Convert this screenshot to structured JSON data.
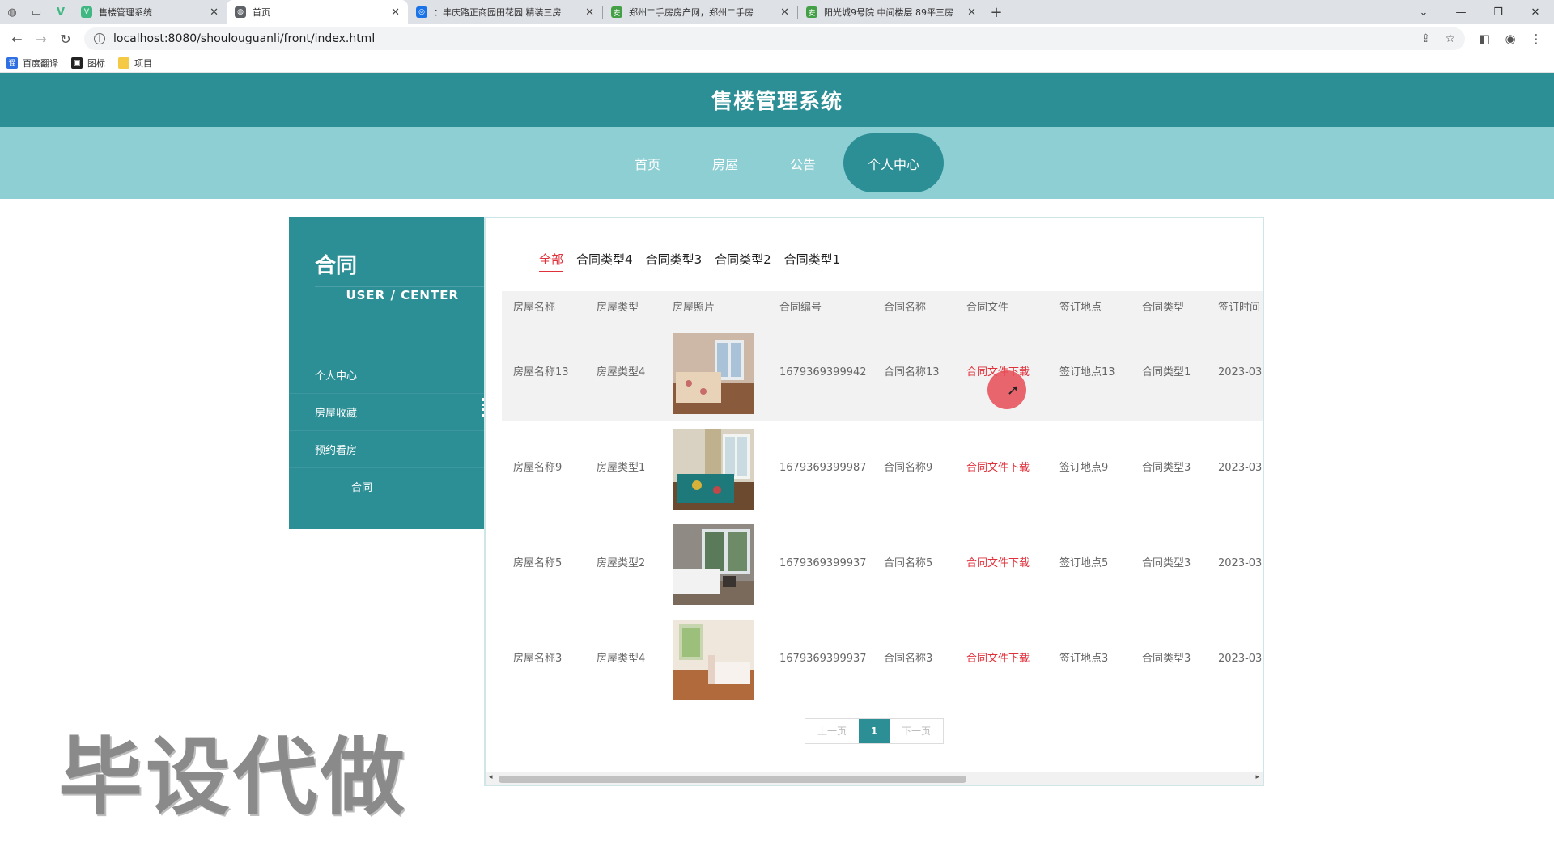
{
  "browser": {
    "tabs": [
      {
        "title": "售楼管理系统",
        "icon": "vue-icon",
        "color": "#41b883",
        "active": false
      },
      {
        "title": "首页",
        "icon": "globe-icon",
        "color": "#5f6368",
        "active": true
      },
      {
        "title": "：丰庆路正商园田花园 精装三房",
        "icon": "browser-icon",
        "color": "#1a73e8",
        "active": false
      },
      {
        "title": "郑州二手房房产网，郑州二手房",
        "icon": "anjuke-icon",
        "color": "#43a047",
        "active": false
      },
      {
        "title": "阳光城9号院 中间楼层 89平三房",
        "icon": "anjuke-icon",
        "color": "#43a047",
        "active": false
      }
    ],
    "url": "localhost:8080/shoulouguanli/front/index.html",
    "bookmarks": [
      "百度翻译",
      "图标",
      "项目"
    ]
  },
  "site": {
    "title": "售楼管理系统",
    "nav": [
      "首页",
      "房屋",
      "公告",
      "个人中心"
    ]
  },
  "sidebar": {
    "title": "合同",
    "subtitle": "USER / CENTER",
    "items": [
      "个人中心",
      "房屋收藏",
      "预约看房",
      "合同"
    ]
  },
  "filters": [
    "全部",
    "合同类型4",
    "合同类型3",
    "合同类型2",
    "合同类型1"
  ],
  "table": {
    "columns": [
      "房屋名称",
      "房屋类型",
      "房屋照片",
      "合同编号",
      "合同名称",
      "合同文件",
      "签订地点",
      "合同类型",
      "签订时间"
    ],
    "rows": [
      {
        "name": "房屋名称13",
        "type": "房屋类型4",
        "photo": "bedroom-photo-1",
        "no": "1679369399942",
        "cname": "合同名称13",
        "file": "合同文件下载",
        "place": "签订地点13",
        "ctype": "合同类型1",
        "time": "2023-03-"
      },
      {
        "name": "房屋名称9",
        "type": "房屋类型1",
        "photo": "bedroom-photo-2",
        "no": "1679369399987",
        "cname": "合同名称9",
        "file": "合同文件下载",
        "place": "签订地点9",
        "ctype": "合同类型3",
        "time": "2023-03-"
      },
      {
        "name": "房屋名称5",
        "type": "房屋类型2",
        "photo": "bedroom-photo-3",
        "no": "1679369399937",
        "cname": "合同名称5",
        "file": "合同文件下载",
        "place": "签订地点5",
        "ctype": "合同类型3",
        "time": "2023-03-"
      },
      {
        "name": "房屋名称3",
        "type": "房屋类型4",
        "photo": "bedroom-photo-4",
        "no": "1679369399937",
        "cname": "合同名称3",
        "file": "合同文件下载",
        "place": "签订地点3",
        "ctype": "合同类型3",
        "time": "2023-03-"
      }
    ]
  },
  "pager": {
    "prev": "上一页",
    "current": "1",
    "next": "下一页"
  },
  "watermark": "毕设代做",
  "colors": {
    "primary": "#2d8f96",
    "nav": "#8ecfd4",
    "link": "#e0303a"
  }
}
